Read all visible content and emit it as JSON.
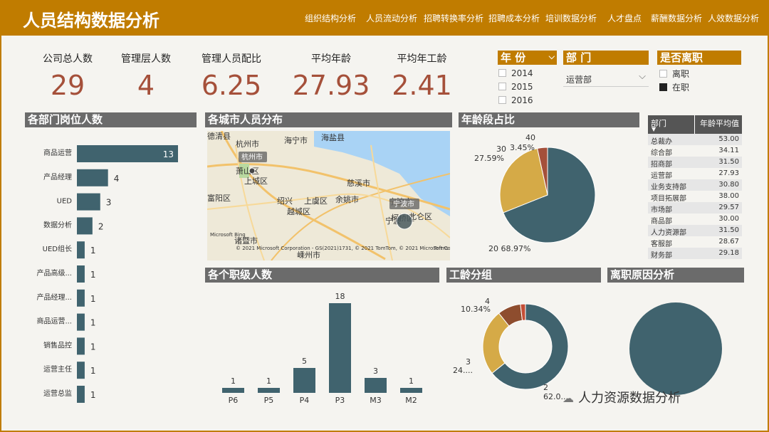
{
  "app": {
    "title": "人员结构数据分析"
  },
  "nav": [
    "组织结构分析",
    "人员流动分析",
    "招聘转换率分析",
    "招聘成本分析",
    "培训数据分析",
    "人才盘点",
    "薪酬数据分析",
    "人效数据分析"
  ],
  "kpis": [
    {
      "label": "公司总人数",
      "value": "29"
    },
    {
      "label": "管理层人数",
      "value": "4"
    },
    {
      "label": "管理人员配比",
      "value": "6.25"
    },
    {
      "label": "平均年龄",
      "value": "27.93"
    },
    {
      "label": "平均年工龄",
      "value": "2.41"
    }
  ],
  "filters": {
    "year": {
      "title": "年 份",
      "options": [
        "2014",
        "2015",
        "2016"
      ]
    },
    "dept": {
      "title": "部 门",
      "selected": "运营部"
    },
    "resigned": {
      "title": "是否离职",
      "options": [
        {
          "label": "离职",
          "checked": false
        },
        {
          "label": "在职",
          "checked": true
        }
      ]
    }
  },
  "panels": {
    "dept_positions": "各部门岗位人数",
    "city_map": "各城市人员分布",
    "age_share": "年龄段占比",
    "level_count": "各个职级人数",
    "tenure": "工龄分组",
    "resign_reason": "离职原因分析"
  },
  "map": {
    "labels": [
      "德清县",
      "海宁市",
      "海盐县",
      "杭州市",
      "上城区",
      "慈溪市",
      "萧山区",
      "绍兴",
      "上虞区",
      "余姚市",
      "宁波市",
      "柯桥区",
      "越城区",
      "宁波",
      "北仑区",
      "诸暨市",
      "嵊州市",
      "富阳区"
    ],
    "bubbles": [
      "杭州市",
      "宁波市"
    ],
    "copyright": "© 2021 Microsoft Corporation - GS(2021)1731, © 2021 TomTom, © 2021 Microsoft Corporation",
    "terms": "Terms",
    "brand": "Microsoft Bing"
  },
  "age_table": {
    "headers": [
      "部门",
      "年龄平均值"
    ],
    "rows": [
      [
        "总裁办",
        "53.00"
      ],
      [
        "综合部",
        "34.11"
      ],
      [
        "招商部",
        "31.50"
      ],
      [
        "运营部",
        "27.93"
      ],
      [
        "业务支持部",
        "30.80"
      ],
      [
        "项目拓展部",
        "38.00"
      ],
      [
        "市场部",
        "29.57"
      ],
      [
        "商品部",
        "30.00"
      ],
      [
        "人力资源部",
        "31.50"
      ],
      [
        "客服部",
        "28.67"
      ],
      [
        "财务部",
        "29.18"
      ]
    ]
  },
  "watermark": "人力资源数据分析",
  "chart_data": [
    {
      "type": "bar",
      "orientation": "horizontal",
      "categories": [
        "商品运营",
        "产品经理",
        "UED",
        "数据分析",
        "UED组长",
        "产品高级...",
        "产品经理...",
        "商品运营...",
        "销售品控",
        "运营主任",
        "运营总监"
      ],
      "values": [
        13,
        4,
        3,
        2,
        1,
        1,
        1,
        1,
        1,
        1,
        1
      ],
      "color": "#40636e"
    },
    {
      "type": "pie",
      "labels": [
        "20",
        "30",
        "40"
      ],
      "values": [
        20,
        8,
        1
      ],
      "percent_labels": [
        "68.97%",
        "27.59%",
        "3.45%"
      ],
      "colors": [
        "#40636e",
        "#d5aa47",
        "#a5503a"
      ]
    },
    {
      "type": "bar",
      "categories": [
        "P6",
        "P5",
        "P4",
        "P3",
        "M3",
        "M2"
      ],
      "values": [
        1,
        1,
        5,
        18,
        3,
        1
      ],
      "color": "#40636e"
    },
    {
      "type": "pie",
      "donut": true,
      "labels": [
        "2",
        "3",
        "4"
      ],
      "values": [
        18,
        7,
        3
      ],
      "percent_labels": [
        "62.0...",
        "24....",
        "10.34%"
      ],
      "colors": [
        "#40636e",
        "#d5aa47",
        "#8e4d2e"
      ],
      "extra_color": "#c44e36"
    },
    {
      "type": "pie",
      "values": [
        1
      ],
      "colors": [
        "#40636e"
      ]
    }
  ]
}
